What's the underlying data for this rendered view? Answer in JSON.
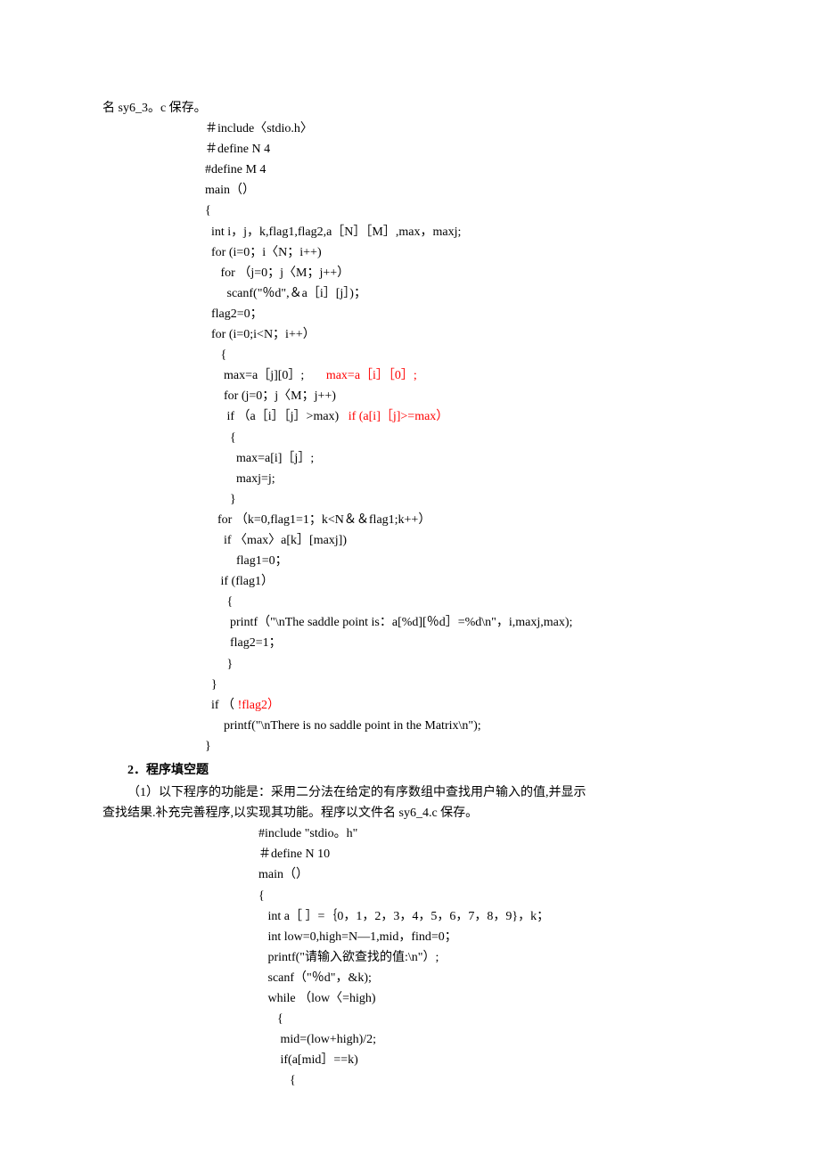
{
  "topLine": "名 sy6_3。c 保存。",
  "code1": [
    "＃include〈stdio.h〉",
    "＃define N 4",
    "#define M 4",
    "main（）",
    "{",
    "  int i，j，k,flag1,flag2,a［N］［M］,max，maxj;",
    "  for (i=0；i〈N；i++)",
    "     for （j=0；j〈M；j++）",
    "       scanf(\"％d\",＆a［i］[j］)；",
    "  flag2=0；",
    "  for (i=0;i<N；i++）",
    "     {",
    "      max=a［j][0］;       ",
    "      for (j=0；j〈M；j++)",
    "       if （a［i］［j］>max)   ",
    "        {",
    "          max=a[i]［j］;",
    "          maxj=j;",
    "        }",
    "    for （k=0,flag1=1；k<N＆＆flag1;k++）",
    "      if 〈max〉a[k］[maxj])",
    "          flag1=0；",
    "     if (flag1）",
    "       {",
    "        printf（\"\\nThe saddle point is：a[%d][％d］=%d\\n\"，i,maxj,max);",
    "        flag2=1；",
    "       }",
    "  }",
    "  if （ ",
    "      printf(\"\\nThere is no saddle point in the Matrix\\n\");",
    "}"
  ],
  "redFix1": "max=a［i］［0］;",
  "redFix2": "if (a[i]［j]>=max）",
  "redFix3": "!flag2）",
  "section2": "2．程序填空题",
  "para2_l1": "（1）以下程序的功能是：采用二分法在给定的有序数组中查找用户输入的值,并显示",
  "para2_l2": "查找结果.补充完善程序,以实现其功能。程序以文件名 sy6_4.c 保存。",
  "code2": [
    "#include \"stdio。h\"",
    "＃define N 10",
    "main（）",
    "{",
    "   int a［ ］=｛0，1，2，3，4，5，6，7，8，9}，k；",
    "   int low=0,high=N—1,mid，find=0；",
    "   printf(\"请输入欲查找的值:\\n\"）;",
    "   scanf（\"％d\"，&k);",
    "   while （low〈=high)",
    "      {",
    "       mid=(low+high)/2;",
    "       if(a[mid］==k)",
    "          {"
  ]
}
